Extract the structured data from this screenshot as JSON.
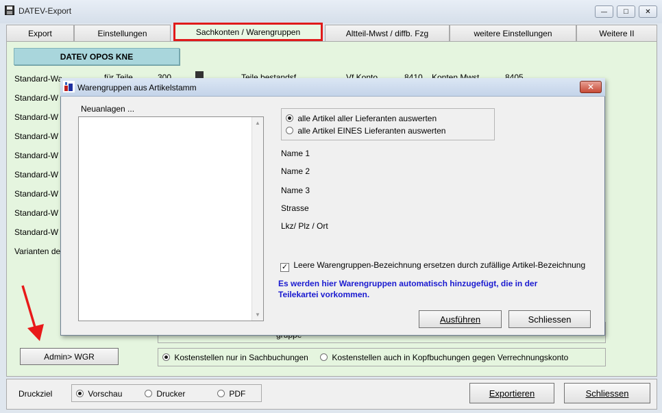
{
  "window": {
    "title": "DATEV-Export",
    "controls": {
      "minimize": "—",
      "maximize": "□",
      "close": "✕"
    }
  },
  "tabs": [
    {
      "label": "Export"
    },
    {
      "label": "Einstellungen"
    },
    {
      "label": "Sachkonten / Warengruppen"
    },
    {
      "label": "Altteil-Mwst / diffb. Fzg"
    },
    {
      "label": "weitere Einstellungen"
    },
    {
      "label": "Weitere II"
    }
  ],
  "main": {
    "opos_button": "DATEV OPOS KNE",
    "row_labels": [
      "Standard-Wa",
      "Standard-W",
      "Standard-W",
      "Standard-W",
      "Standard-W",
      "Standard-W",
      "Standard-W",
      "Standard-W",
      "Standard-W",
      "Varianten de"
    ],
    "peek_texts": {
      "a": "für Teile",
      "b": "300",
      "c": "Teile bestandsf.",
      "d": "Vf Konto",
      "e": "8410",
      "f": "Konten Mwst",
      "g": "8405",
      "h": "gruppe"
    },
    "admin_button": "Admin> WGR",
    "kostenstellen": {
      "option1": "Kostenstellen nur in Sachbuchungen",
      "option2": "Kostenstellen auch in Kopfbuchungen gegen Verrechnungskonto"
    }
  },
  "footer": {
    "label": "Druckziel",
    "options": [
      "Vorschau",
      "Drucker",
      "PDF"
    ],
    "export_button": "Exportieren",
    "close_button": "Schliessen"
  },
  "dialog": {
    "title": "Warengruppen aus Artikelstamm",
    "list_label": "Neuanlagen ...",
    "radio_all": "alle Artikel aller Lieferanten auswerten",
    "radio_one": "alle Artikel EINES Lieferanten auswerten",
    "fields": [
      "Name 1",
      "Name 2",
      "Name 3",
      "Strasse",
      "Lkz/ Plz / Ort"
    ],
    "checkbox_label": "Leere Warengruppen-Bezeichnung ersetzen durch zufällige Artikel-Bezeichnung",
    "info_line1": "Es werden hier Warengruppen automatisch hinzugefügt, die in der",
    "info_line2": "Teilekartei vorkommen.",
    "run_button": "Ausführen",
    "close_button": "Schliessen"
  },
  "colors": {
    "highlight": "#e01a1a",
    "info_text": "#1a1ad0",
    "content_bg": "#e5f5df"
  }
}
